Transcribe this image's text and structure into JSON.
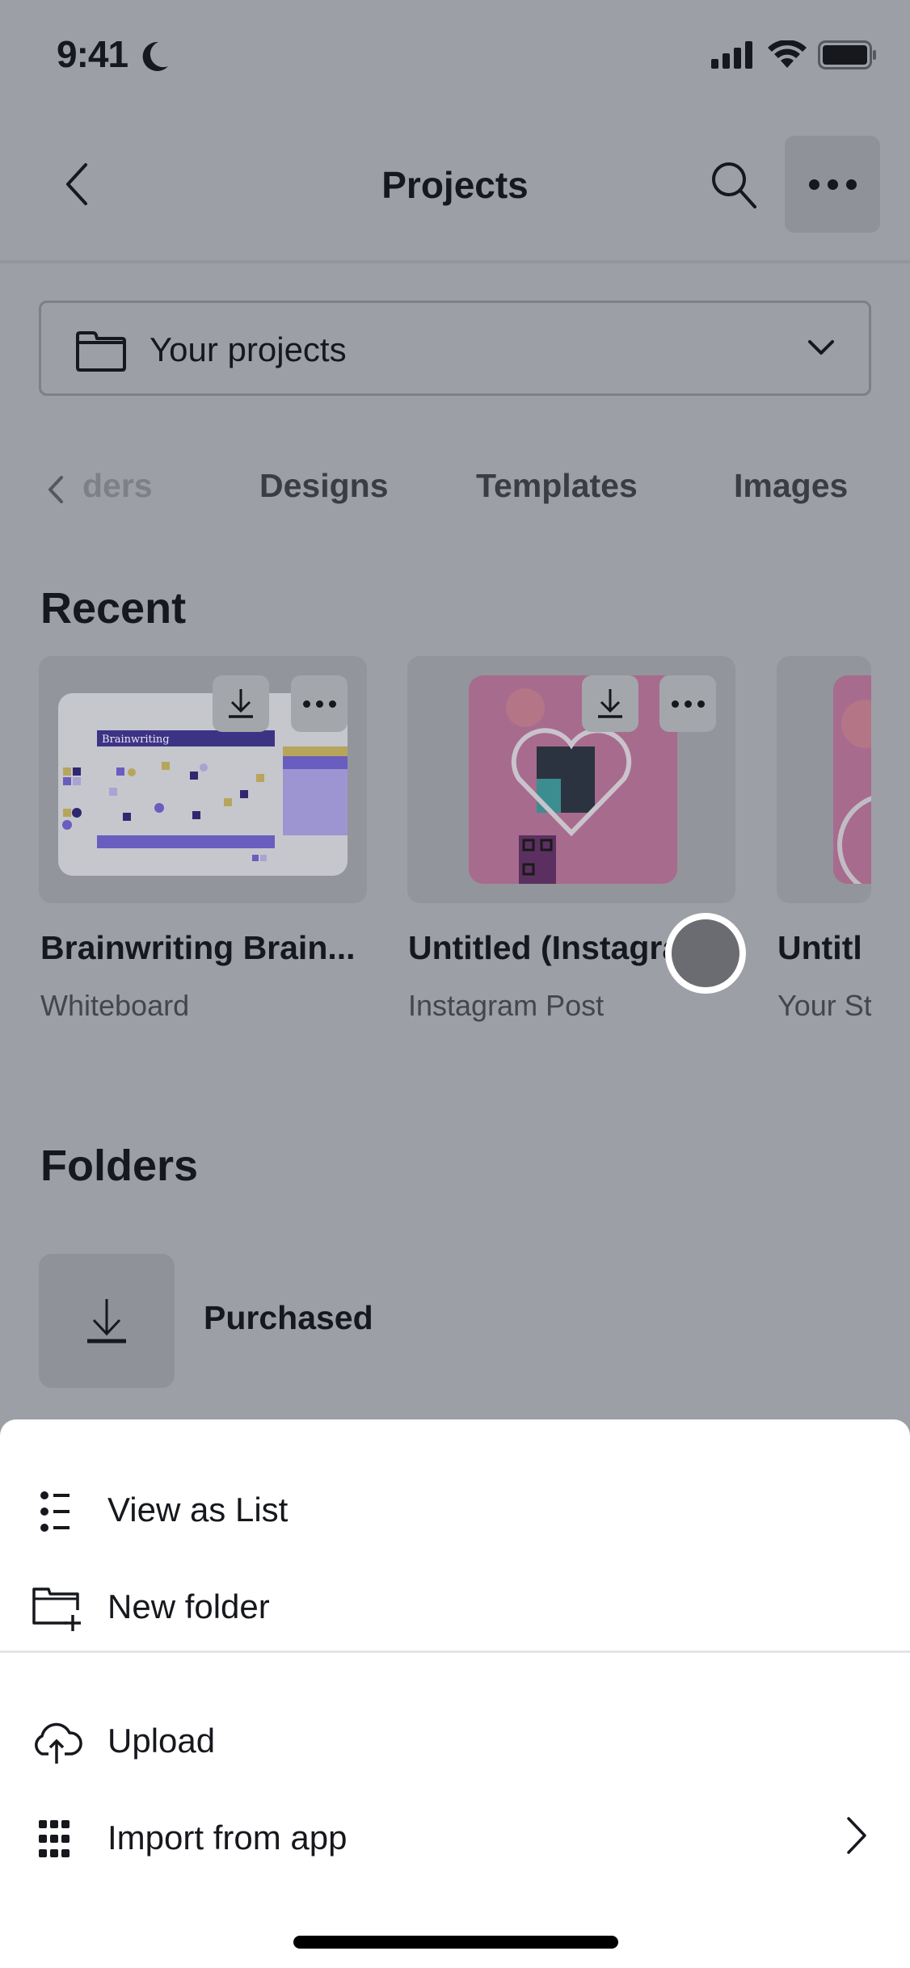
{
  "status_bar": {
    "time": "9:41",
    "focus_mode_icon": "moon-icon",
    "signal_icon": "cellular-signal-icon",
    "wifi_icon": "wifi-icon",
    "battery_icon": "battery-full-icon"
  },
  "nav": {
    "title": "Projects",
    "back_icon": "chevron-left-icon",
    "search_icon": "search-icon",
    "more_icon": "more-horizontal-icon"
  },
  "location_dropdown": {
    "icon": "folder-icon",
    "selected": "Your projects",
    "chevron_icon": "chevron-down-icon"
  },
  "tabs": [
    {
      "label": "ders",
      "full_label": "Folders"
    },
    {
      "label": "Designs"
    },
    {
      "label": "Templates"
    },
    {
      "label": "Images"
    }
  ],
  "recent": {
    "title": "Recent",
    "items": [
      {
        "title": "Brainwriting Brain...",
        "type": "Whiteboard",
        "thumb_text": "Brainwriting"
      },
      {
        "title": "Untitled (Instagra...",
        "type": "Instagram Post"
      },
      {
        "title": "Untitl",
        "type": "Your St"
      }
    ]
  },
  "folders": {
    "title": "Folders",
    "items": [
      {
        "name": "Purchased",
        "icon": "download-icon"
      }
    ]
  },
  "action_sheet": {
    "items": [
      {
        "label": "View as List",
        "icon": "list-icon"
      },
      {
        "label": "New folder",
        "icon": "folder-plus-icon"
      },
      {
        "label": "Upload",
        "icon": "cloud-upload-icon"
      },
      {
        "label": "Import from app",
        "icon": "apps-grid-icon",
        "has_submenu": true
      }
    ]
  },
  "colors": {
    "overlay_bg": "#9c9fa5",
    "sheet_bg": "#ffffff",
    "text_primary": "#16181d",
    "brainwriting_purple": "#3d3385",
    "instagram_pink": "#b0678e"
  }
}
